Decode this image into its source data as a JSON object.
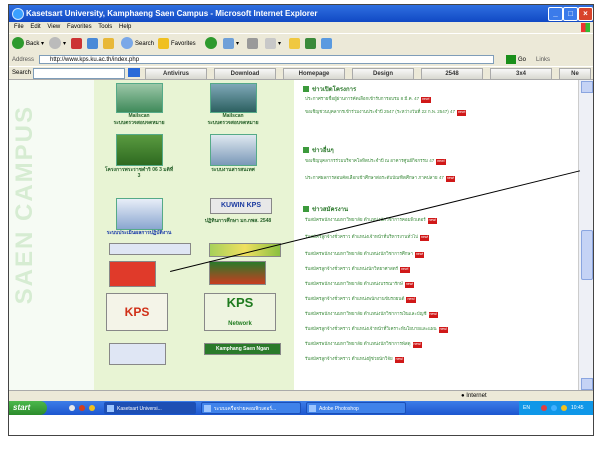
{
  "window": {
    "title": "Kasetsart University, Kamphaeng Saen Campus - Microsoft Internet Explorer"
  },
  "menu": [
    "File",
    "Edit",
    "View",
    "Favorites",
    "Tools",
    "Help"
  ],
  "toolbar": {
    "back": "Back",
    "search": "Search",
    "favorites": "Favorites"
  },
  "address": {
    "label": "Address",
    "url": "http://www.kps.ku.ac.th/index.php",
    "go": "Go",
    "links": "Links"
  },
  "navbar": {
    "search_label": "Search",
    "tabs": [
      "Antivirus",
      "Download",
      "Homepage",
      "Design",
      "2548",
      "3x4",
      "Ne"
    ]
  },
  "page": {
    "campus_text": "SAEN CAMPUS",
    "items": {
      "mailscan_1": "Mailscan",
      "mailscan_2": "Mailscan",
      "kuwin": "KUWIN KPS",
      "kps_banner": "KPS",
      "kps_network": "KPS",
      "network_label": "Network",
      "kamphaeng": "Kamphang Saen Ngan"
    },
    "thai_captions": {
      "c1": "ระบบตรวจสอบจดหมาย",
      "c2": "ระบบตรวจสอบจดหมาย",
      "c3": "โครงการพระราชดำริ 06 3 มติที่ 3",
      "c4": "ระบบงานสารสนเทศ",
      "c5": "ระบบประเมินผลการปฏิบัติงาน",
      "c6": "ปฏิทินการศึกษา มก.กพส. 2548"
    },
    "sections": [
      {
        "heading": "ข่าวเปิดโครงการ",
        "lines": [
          "ประกาศรายชื่อผู้ผ่านการคัดเลือกเข้ารับการอบรม 8 มี.ค. 47",
          "ขอเชิญชวนบุคลากรเข้าร่วมงานประจำปี 2547 (ระหว่างวันที่ 22 ก.พ. 2547) 47"
        ]
      },
      {
        "heading": "ข่าวอื่นๆ",
        "lines": [
          "ขอเชิญบุคลากรร่วมบริจาคโลหิตประจำปี ณ อาคารศูนย์กิจกรรม 47",
          "ประกาศผลการสอบคัดเลือกเข้าศึกษาต่อระดับบัณฑิตศึกษา ภาคปลาย 47"
        ]
      },
      {
        "heading": "ข่าวสมัครงาน",
        "lines": [
          "รับสมัครพนักงานมหาวิทยาลัย ตำแหน่งนักวิชาการคอมพิวเตอร์",
          "รับสมัครลูกจ้างชั่วคราว ตำแหน่งเจ้าหน้าที่บริหารงานทั่วไป",
          "รับสมัครพนักงานมหาวิทยาลัย ตำแหน่งนักวิชาการศึกษา",
          "รับสมัครลูกจ้างชั่วคราว ตำแหน่งนักวิทยาศาสตร์",
          "รับสมัครพนักงานมหาวิทยาลัย ตำแหน่งบรรณารักษ์",
          "รับสมัครลูกจ้างชั่วคราว ตำแหน่งพนักงานขับรถยนต์",
          "รับสมัครพนักงานมหาวิทยาลัย ตำแหน่งนักวิชาการเงินและบัญชี",
          "รับสมัครลูกจ้างชั่วคราว ตำแหน่งเจ้าหน้าที่วิเคราะห์นโยบายและแผน",
          "รับสมัครพนักงานมหาวิทยาลัย ตำแหน่งนักวิชาการพัสดุ",
          "รับสมัครลูกจ้างชั่วคราว ตำแหน่งผู้ช่วยนักวิจัย"
        ]
      }
    ],
    "new_badge": "new!"
  },
  "status": {
    "zone": "Internet"
  },
  "taskbar": {
    "start": "start",
    "tasks": [
      "Kasetsart Universi...",
      "ระบบเครือข่ายคอมพิวเตอร์...",
      "Adobe Photoshop"
    ],
    "tray_lang": "EN",
    "clock": "10:45"
  },
  "colors": {
    "title_bar": "#1149c4",
    "center_panel": "#e8f4d4",
    "section_green": "#2d7a2d",
    "new_badge": "#d01818"
  }
}
